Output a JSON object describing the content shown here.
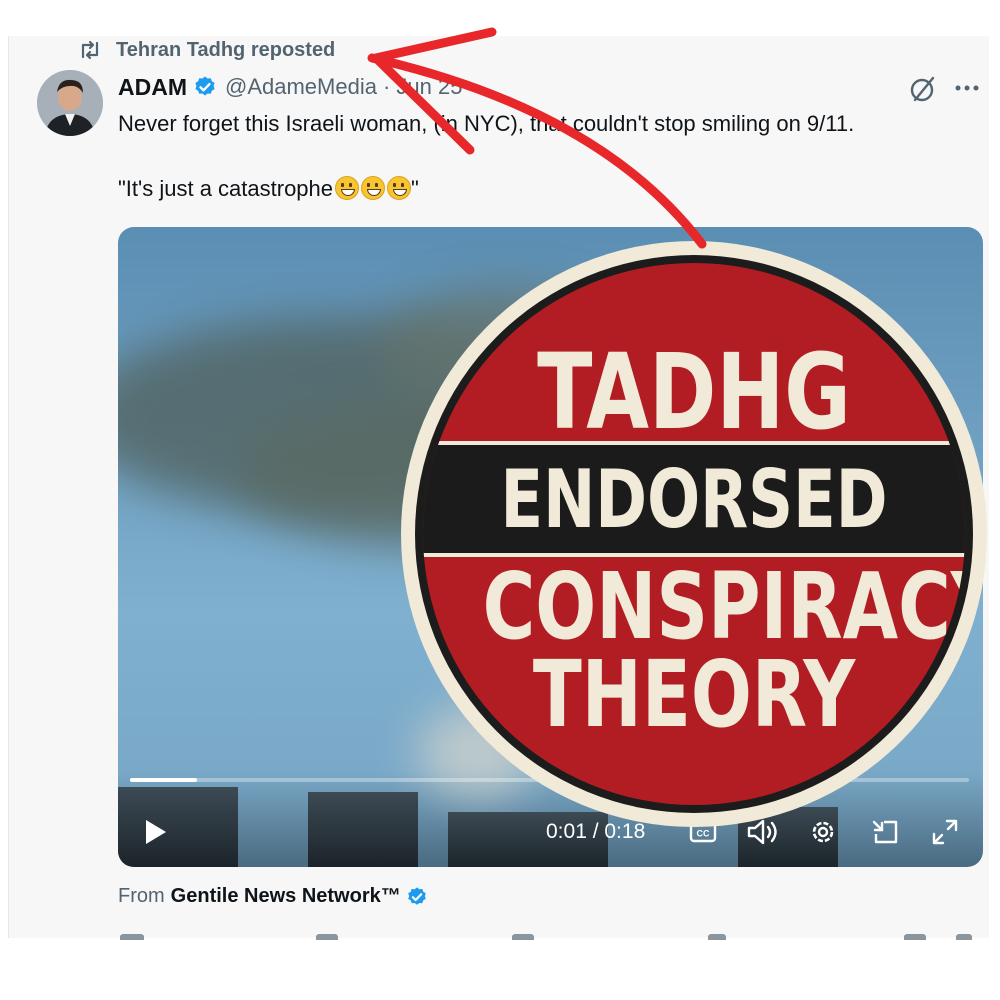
{
  "repost": {
    "text": "Tehran Tadhg reposted",
    "icon": "repost-icon"
  },
  "tweet": {
    "author_name": "ADAM",
    "author_handle": "@AdameMedia",
    "date": "Jun 25",
    "line1": "Never forget this Israeli woman, (in NYC), that couldn't stop smiling on 9/11.",
    "line2": "\"It's just a catastrophe",
    "line2_end": "\""
  },
  "video": {
    "time": "0:01 / 0:18",
    "progress": 0.08
  },
  "from": {
    "prefix": "From",
    "source": "Gentile News Network™"
  },
  "badge": {
    "line1": "TADHG",
    "line2": "ENDORSED",
    "line3": "CONSPIRACY",
    "line4": "THEORY"
  },
  "colors": {
    "accent_blue": "#1d9bf0",
    "badge_red": "#b21d24",
    "badge_cream": "#f1ead8",
    "arrow_red": "#e8272a"
  }
}
